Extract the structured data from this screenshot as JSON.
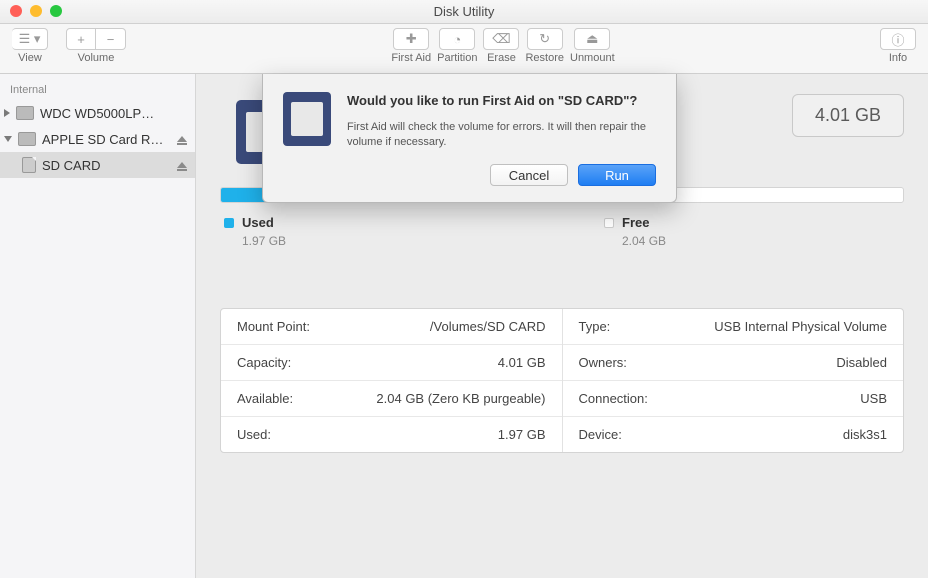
{
  "window": {
    "title": "Disk Utility"
  },
  "toolbar": {
    "view": "View",
    "volume": "Volume",
    "first_aid": "First Aid",
    "partition": "Partition",
    "erase": "Erase",
    "restore": "Restore",
    "unmount": "Unmount",
    "info": "Info"
  },
  "sidebar": {
    "header": "Internal",
    "items": [
      {
        "label": "WDC WD5000LP…"
      },
      {
        "label": "APPLE SD Card R…"
      },
      {
        "label": "SD CARD"
      }
    ]
  },
  "main": {
    "size_badge": "4.01 GB",
    "legend": {
      "used_label": "Used",
      "used_value": "1.97 GB",
      "free_label": "Free",
      "free_value": "2.04 GB"
    },
    "info": {
      "left": [
        {
          "label": "Mount Point:",
          "value": "/Volumes/SD CARD"
        },
        {
          "label": "Capacity:",
          "value": "4.01 GB"
        },
        {
          "label": "Available:",
          "value": "2.04 GB (Zero KB purgeable)"
        },
        {
          "label": "Used:",
          "value": "1.97 GB"
        }
      ],
      "right": [
        {
          "label": "Type:",
          "value": "USB Internal Physical Volume"
        },
        {
          "label": "Owners:",
          "value": "Disabled"
        },
        {
          "label": "Connection:",
          "value": "USB"
        },
        {
          "label": "Device:",
          "value": "disk3s1"
        }
      ]
    }
  },
  "dialog": {
    "title": "Would you like to run First Aid on \"SD CARD\"?",
    "desc": "First Aid will check the volume for errors. It will then repair the volume if necessary.",
    "cancel": "Cancel",
    "run": "Run"
  }
}
